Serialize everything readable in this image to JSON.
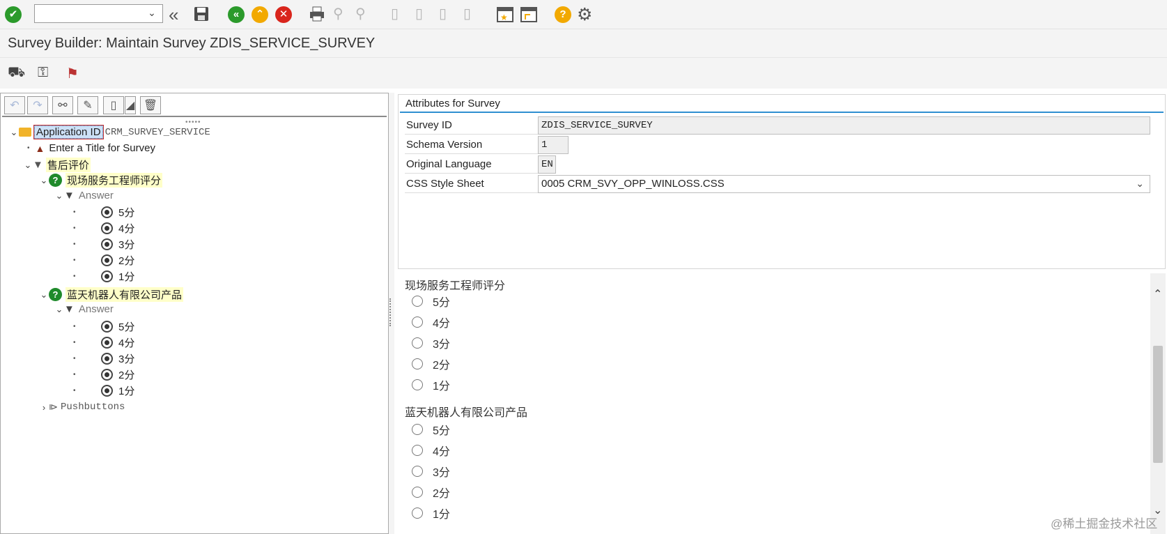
{
  "toolbar": {
    "command_field_value": "",
    "icons": [
      "enter-icon",
      "back-double-icon",
      "save-icon",
      "back-icon",
      "exit-icon",
      "cancel-icon",
      "print-icon",
      "find-icon",
      "find-next-icon",
      "first-page-icon",
      "prev-page-icon",
      "next-page-icon",
      "last-page-icon",
      "new-session-icon",
      "shortcut-icon",
      "help-icon",
      "settings-icon"
    ],
    "enter_glyph": "✔",
    "back_glyph": "«",
    "exit_glyph": "⌃",
    "cancel_glyph": "✕",
    "help_glyph": "?",
    "collapse_glyph": "«",
    "settings_glyph": "⚙"
  },
  "title": "Survey Builder: Maintain Survey ZDIS_SERVICE_SURVEY",
  "tree": {
    "root_label": "Application ID",
    "root_value": "CRM_SURVEY_SERVICE",
    "title_node": "Enter a Title for Survey",
    "section": "售后评价",
    "questions": [
      {
        "label": "现场服务工程师评分",
        "answer_label": "Answer",
        "options": [
          "5分",
          "4分",
          "3分",
          "2分",
          "1分"
        ]
      },
      {
        "label": "蓝天机器人有限公司产品",
        "answer_label": "Answer",
        "options": [
          "5分",
          "4分",
          "3分",
          "2分",
          "1分"
        ]
      }
    ],
    "pushbuttons": "Pushbuttons"
  },
  "attributes": {
    "title": "Attributes for Survey",
    "rows": [
      {
        "label": "Survey ID",
        "value": "ZDIS_SERVICE_SURVEY"
      },
      {
        "label": "Schema Version",
        "value": "1"
      },
      {
        "label": "Original Language",
        "value": "EN"
      },
      {
        "label": "CSS Style Sheet",
        "value": "0005 CRM_SVY_OPP_WINLOSS.CSS"
      }
    ]
  },
  "preview": {
    "questions": [
      {
        "label": "现场服务工程师评分",
        "options": [
          "5分",
          "4分",
          "3分",
          "2分",
          "1分"
        ]
      },
      {
        "label": "蓝天机器人有限公司产品",
        "options": [
          "5分",
          "4分",
          "3分",
          "2分",
          "1分"
        ]
      }
    ]
  },
  "watermark": "@稀土掘金技术社区"
}
